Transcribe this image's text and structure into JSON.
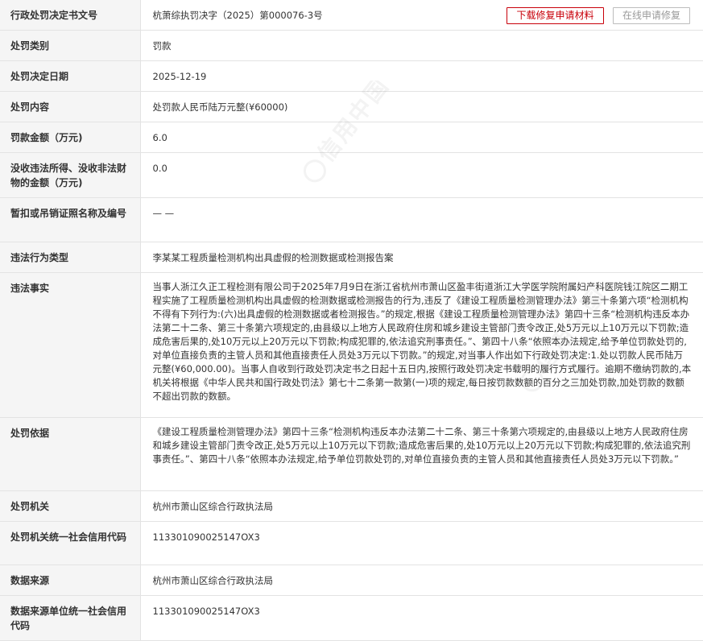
{
  "buttons": {
    "download_label": "下载修复申请材料",
    "online_label": "在线申请修复"
  },
  "watermark": "信用中国",
  "rows": [
    {
      "label": "行政处罚决定书文号",
      "value": "杭萧综执罚决字（2025）第000076-3号"
    },
    {
      "label": "处罚类别",
      "value": "罚款"
    },
    {
      "label": "处罚决定日期",
      "value": "2025-12-19"
    },
    {
      "label": "处罚内容",
      "value": "处罚款人民币陆万元整(¥60000)"
    },
    {
      "label": "罚款金额（万元)",
      "value": "6.0"
    },
    {
      "label": "没收违法所得、没收非法财物的金额（万元)",
      "value": "0.0"
    },
    {
      "label": "暂扣或吊销证照名称及编号",
      "value": "— —"
    },
    {
      "label": "违法行为类型",
      "value": "李某某工程质量检测机构出具虚假的检测数据或检测报告案"
    },
    {
      "label": "违法事实",
      "value": "当事人浙江久正工程检测有限公司于2025年7月9日在浙江省杭州市萧山区盈丰街道浙江大学医学院附属妇产科医院钱江院区二期工程实施了工程质量检测机构出具虚假的检测数据或检测报告的行为,违反了《建设工程质量检测管理办法》第三十条第六项“检测机构不得有下列行为:(六)出具虚假的检测数据或者检测报告。”的规定,根据《建设工程质量检测管理办法》第四十三条“检测机构违反本办法第二十二条、第三十条第六项规定的,由县级以上地方人民政府住房和城乡建设主管部门责令改正,处5万元以上10万元以下罚款;造成危害后果的,处10万元以上20万元以下罚款;构成犯罪的,依法追究刑事责任。”、第四十八条“依照本办法规定,给予单位罚款处罚的,对单位直接负责的主管人员和其他直接责任人员处3万元以下罚款。”的规定,对当事人作出如下行政处罚决定:1.处以罚款人民币陆万元整(¥60,000.00)。当事人自收到行政处罚决定书之日起十五日内,按照行政处罚决定书载明的履行方式履行。逾期不缴纳罚款的,本机关将根据《中华人民共和国行政处罚法》第七十二条第一款第(一)项的规定,每日按罚款数额的百分之三加处罚款,加处罚款的数额不超出罚款的数额。"
    },
    {
      "label": "处罚依据",
      "value": "《建设工程质量检测管理办法》第四十三条“检测机构违反本办法第二十二条、第三十条第六项规定的,由县级以上地方人民政府住房和城乡建设主管部门责令改正,处5万元以上10万元以下罚款;造成危害后果的,处10万元以上20万元以下罚款;构成犯罪的,依法追究刑事责任。”、第四十八条“依照本办法规定,给予单位罚款处罚的,对单位直接负责的主管人员和其他直接责任人员处3万元以下罚款。”"
    },
    {
      "label": "处罚机关",
      "value": "杭州市萧山区综合行政执法局"
    },
    {
      "label": "处罚机关统一社会信用代码",
      "value": "113301090025147OX3"
    },
    {
      "label": "数据来源",
      "value": "杭州市萧山区综合行政执法局"
    },
    {
      "label": "数据来源单位统一社会信用代码",
      "value": "113301090025147OX3"
    }
  ]
}
